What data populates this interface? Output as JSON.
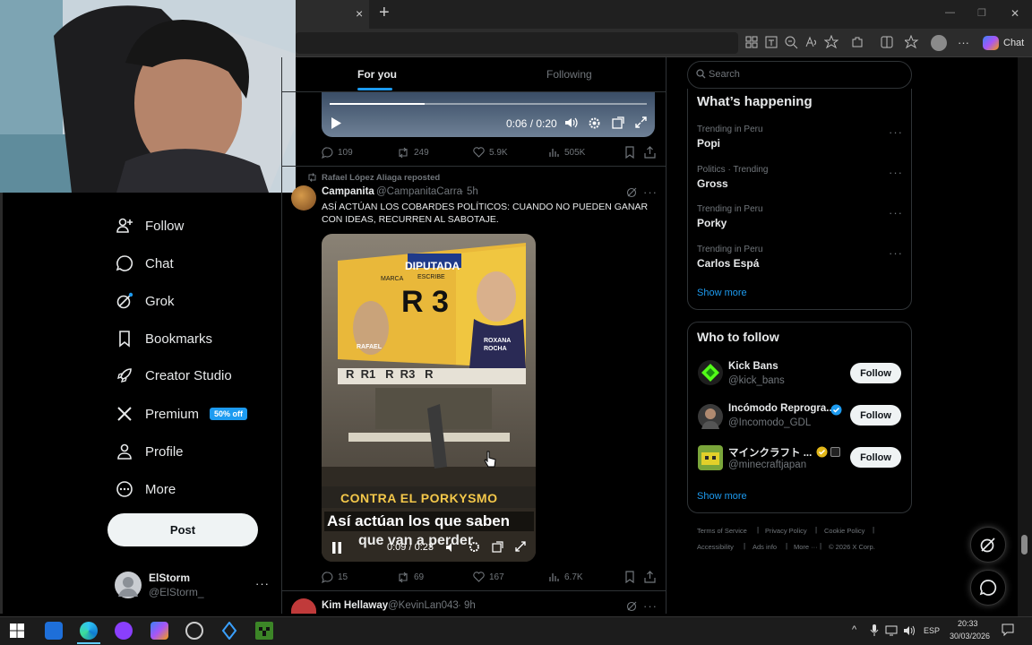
{
  "browser": {
    "close_tab": "×",
    "new_tab": "+",
    "chat_label": "Chat",
    "min": "—",
    "restore": "❐",
    "close": "✕"
  },
  "feed_tabs": {
    "for_you": "For you",
    "following": "Following"
  },
  "video1": {
    "time": "0:06 / 0:20"
  },
  "tweet1_stats": {
    "replies": "109",
    "reposts": "249",
    "likes": "5.9K",
    "views": "505K"
  },
  "tweet2": {
    "repost_by": "Rafael López Aliaga reposted",
    "author_name": "Campanita",
    "author_handle": "@CampanitaCarra",
    "time": "· 5h",
    "text": "ASÍ ACTÚAN LOS COBARDES POLÍTICOS: CUANDO NO PUEDEN GANAR CON IDEAS, RECURREN AL SABOTAJE.",
    "video": {
      "billboard_top": "DIPUTADA",
      "billboard_marca": "MARCA",
      "billboard_escribe": "ESCRIBE",
      "billboard_number": "R 3",
      "billboard_left_name": "RAFAEL",
      "billboard_right_name": "ROXANA ROCHA",
      "strip": "R  R1   R  R3   R",
      "caption_banner": "CONTRA EL PORKYSMO",
      "subtitle_line1": "Así actúan los que saben",
      "subtitle_line2": "que van a perder",
      "time": "0:09 / 0:23"
    },
    "stats": {
      "replies": "15",
      "reposts": "69",
      "likes": "167",
      "views": "6.7K"
    }
  },
  "tweet3": {
    "author_name": "Kim Hellaway",
    "author_handle": "@KevinLan043",
    "time": "· 9h"
  },
  "sidebar": {
    "items": [
      {
        "label": "Follow",
        "icon": "follow-icon"
      },
      {
        "label": "Chat",
        "icon": "chat-icon"
      },
      {
        "label": "Grok",
        "icon": "grok-icon"
      },
      {
        "label": "Bookmarks",
        "icon": "bookmark-icon"
      },
      {
        "label": "Creator Studio",
        "icon": "rocket-icon"
      },
      {
        "label": "Premium",
        "icon": "x-icon"
      },
      {
        "label": "Profile",
        "icon": "person-icon"
      },
      {
        "label": "More",
        "icon": "more-circle-icon"
      }
    ],
    "premium_badge": "50% off",
    "post_button": "Post",
    "account_name": "ElStorm",
    "account_handle": "@ElStorm_"
  },
  "search": {
    "placeholder": "Search"
  },
  "happening": {
    "title": "What’s happening",
    "trends": [
      {
        "category": "Trending in Peru",
        "name": "Popi"
      },
      {
        "category": "Politics · Trending",
        "name": "Gross"
      },
      {
        "category": "Trending in Peru",
        "name": "Porky"
      },
      {
        "category": "Trending in Peru",
        "name": "Carlos Espá"
      }
    ],
    "show_more": "Show more"
  },
  "who_to_follow": {
    "title": "Who to follow",
    "accounts": [
      {
        "name": "Kick Bans",
        "handle": "@kick_bans",
        "button": "Follow"
      },
      {
        "name": "Incómodo Reprogra...",
        "handle": "@Incomodo_GDL",
        "button": "Follow"
      },
      {
        "name": "マインクラフト ...",
        "handle": "@minecraftjapan",
        "button": "Follow"
      }
    ],
    "show_more": "Show more"
  },
  "footer": {
    "terms": "Terms of Service",
    "privacy": "Privacy Policy",
    "cookie": "Cookie Policy",
    "accessibility": "Accessibility",
    "ads": "Ads info",
    "more": "More ···",
    "copyright": "© 2026 X Corp."
  },
  "taskbar": {
    "lang": "ESP",
    "time": "20:33",
    "date": "30/03/2026"
  },
  "colors": {
    "accent": "#1d9bf0",
    "background": "#000000",
    "border": "#2f3336",
    "muted": "#71767b"
  }
}
